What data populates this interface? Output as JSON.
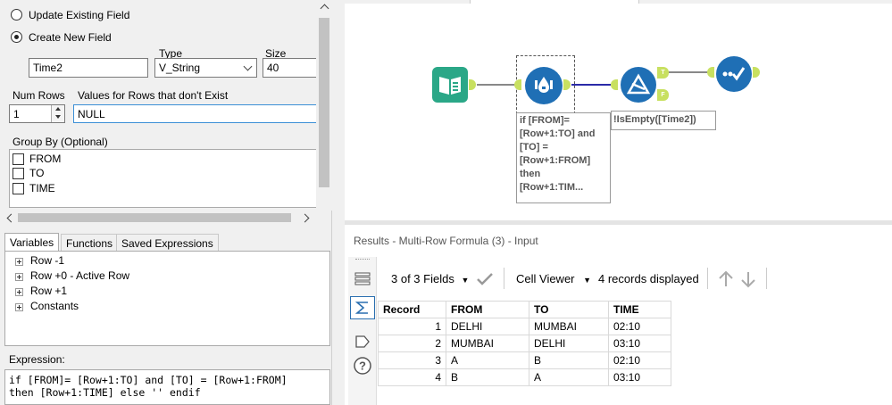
{
  "config": {
    "update_existing_label": "Update Existing Field",
    "create_new_label": "Create New  Field",
    "type_header": "Type",
    "size_header": "Size",
    "field_name": "Time2",
    "field_type": "V_String",
    "field_size": "40",
    "num_rows_label": "Num Rows",
    "values_label": "Values for Rows that don't Exist",
    "num_rows_value": "1",
    "values_value": "NULL",
    "group_by_label": "Group By (Optional)",
    "group_by_fields": [
      "FROM",
      "TO",
      "TIME"
    ]
  },
  "tabs": [
    "Variables",
    "Functions",
    "Saved Expressions"
  ],
  "variables_tree": [
    "Row -1",
    "Row +0 - Active Row",
    "Row +1",
    "Constants"
  ],
  "expression": {
    "label": "Expression:",
    "line1": "if [FROM]= [Row+1:TO] and [TO] = [Row+1:FROM]",
    "line2": "then [Row+1:TIME] else '' endif"
  },
  "canvas": {
    "formula_annotation": [
      "if [FROM]=",
      "[Row+1:TO] and",
      "[TO] =",
      "[Row+1:FROM]",
      "then",
      "[Row+1:TIM..."
    ],
    "filter_annotation": "!IsEmpty([Time2])",
    "filter_true_label": "T",
    "filter_false_label": "F"
  },
  "results": {
    "title": "Results - Multi-Row Formula (3) - Input",
    "fields_summary": "3 of 3 Fields",
    "cell_viewer": "Cell Viewer",
    "records_displayed": "4 records displayed",
    "columns": [
      "Record",
      "FROM",
      "TO",
      "TIME"
    ],
    "rows": [
      [
        "1",
        "DELHI",
        "MUMBAI",
        "02:10"
      ],
      [
        "2",
        "MUMBAI",
        "DELHI",
        "03:10"
      ],
      [
        "3",
        "A",
        "B",
        "02:10"
      ],
      [
        "4",
        "B",
        "A",
        "03:10"
      ]
    ]
  },
  "colors": {
    "input_tool": "#2aa787",
    "formula_tool": "#1f6fb5",
    "filter_tool": "#1f6fb5",
    "connection": "#2a2aa8",
    "anchor": "#c8e060",
    "values_field_border": "#3b8fd6"
  }
}
